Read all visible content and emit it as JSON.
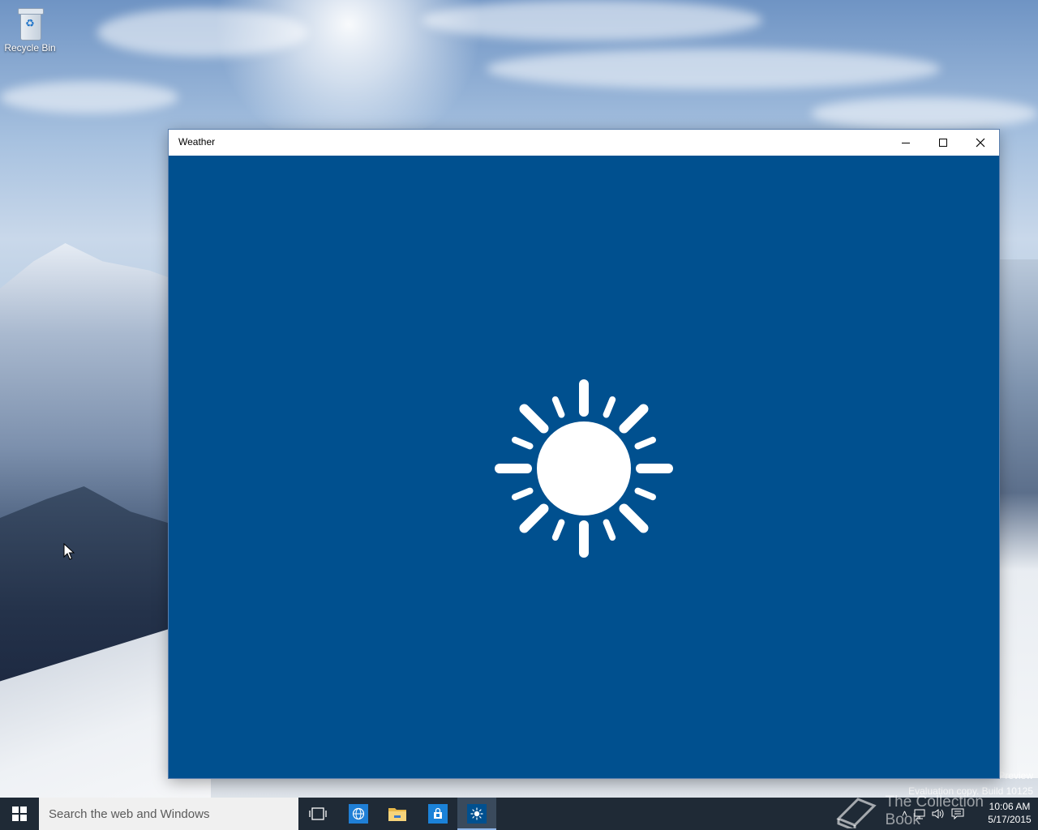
{
  "desktop": {
    "icons": [
      {
        "label": "Recycle Bin",
        "icon": "recycle-bin-icon"
      }
    ],
    "watermark_line1": "Preview",
    "watermark_line2": "Evaluation copy. Build 10125"
  },
  "window": {
    "title": "Weather",
    "splash_icon": "sun-icon",
    "background_color": "#00508f"
  },
  "taskbar": {
    "search_placeholder": "Search the web and Windows",
    "apps": [
      {
        "name": "Internet Explorer",
        "icon": "globe-icon"
      },
      {
        "name": "File Explorer",
        "icon": "folder-icon"
      },
      {
        "name": "Store",
        "icon": "store-icon"
      },
      {
        "name": "Weather",
        "icon": "sun-icon",
        "active": true
      }
    ],
    "clock": {
      "time": "10:06 AM",
      "date": "5/17/2015"
    }
  },
  "overlay": {
    "brand": "The Collection Book"
  }
}
